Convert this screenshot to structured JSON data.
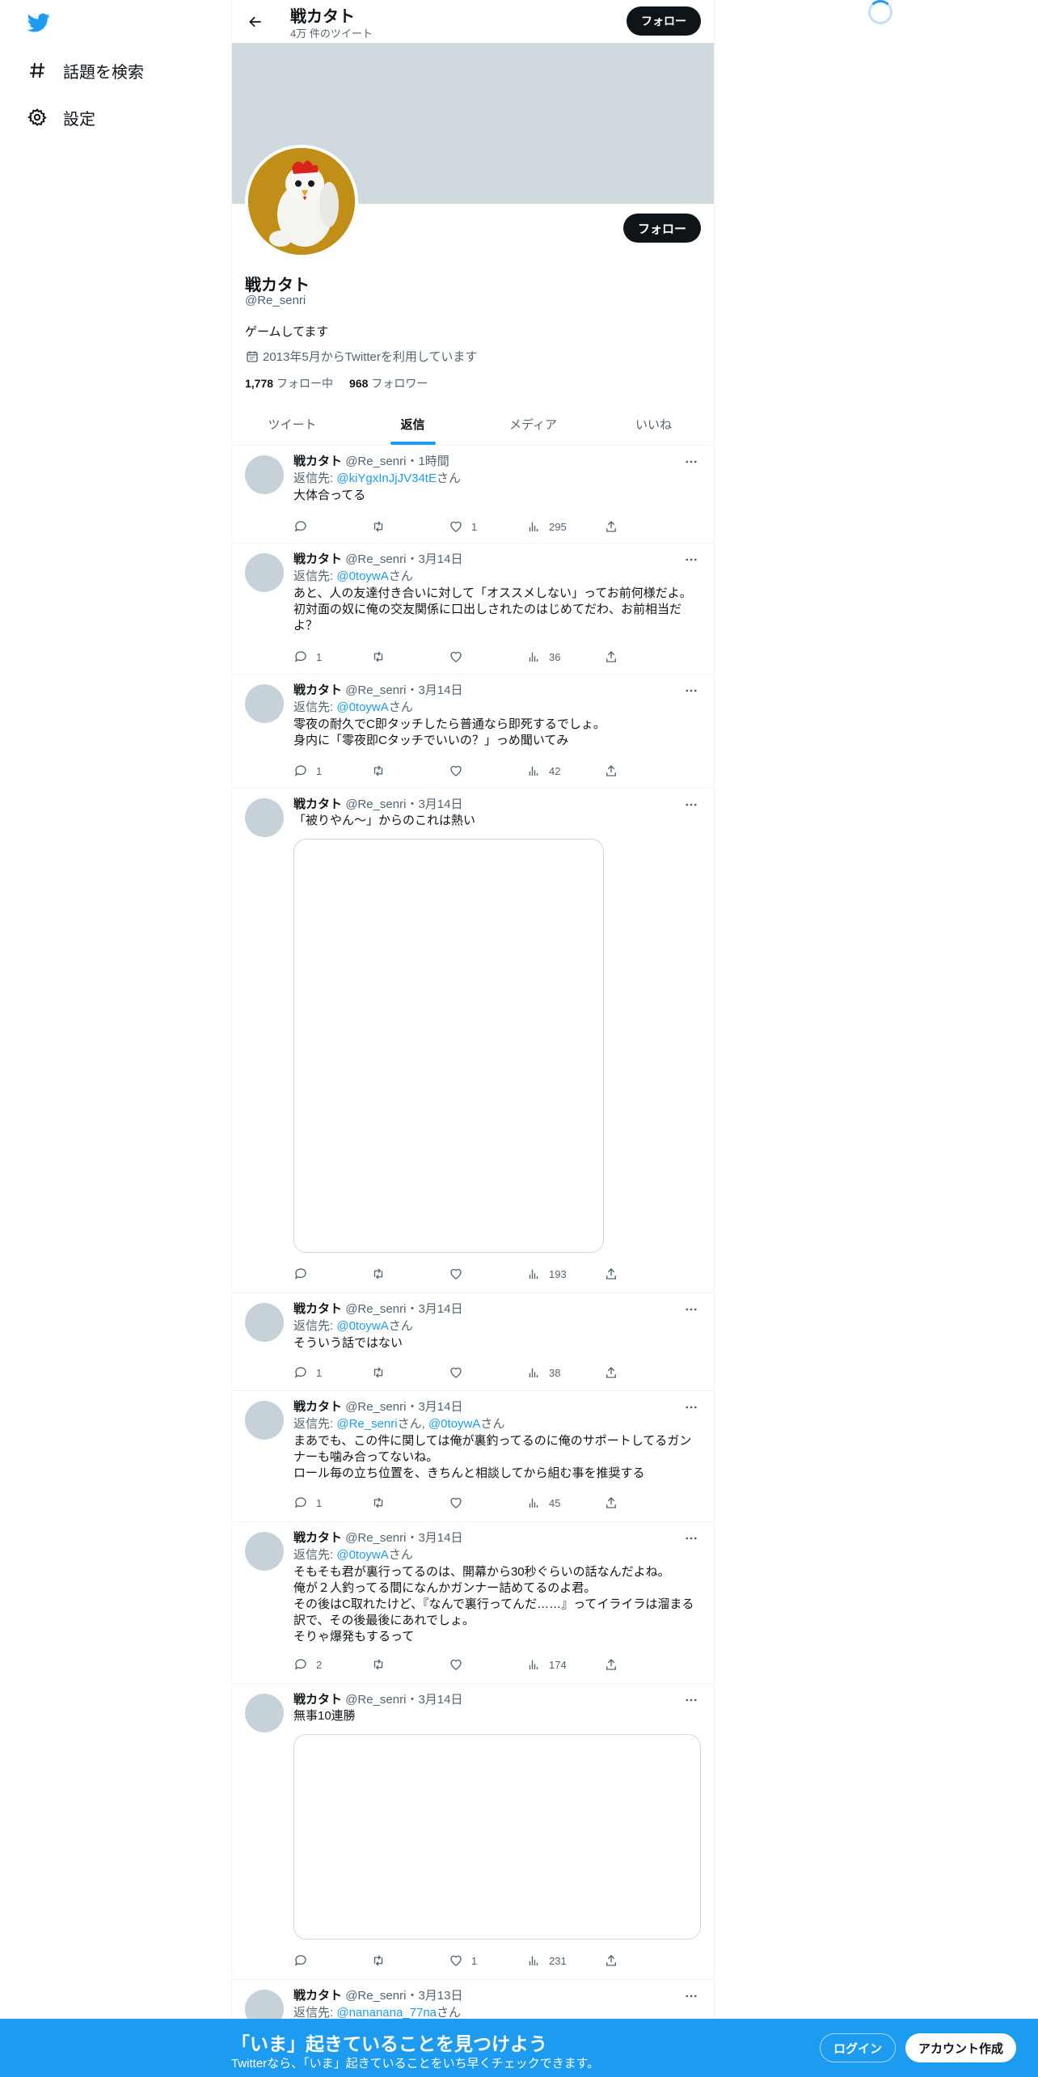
{
  "sidebar": {
    "items": [
      {
        "label": "話題を検索",
        "icon": "hashtag-icon"
      },
      {
        "label": "設定",
        "icon": "gear-icon"
      }
    ]
  },
  "header": {
    "name": "戦カタト",
    "tweet_count": "4万 件のツイート",
    "follow_label": "フォロー"
  },
  "profile": {
    "name": "戦カタト",
    "handle": "@Re_senri",
    "bio": "ゲームしてます",
    "joined": "2013年5月からTwitterを利用しています",
    "following_count": "1,778",
    "following_label": "フォロー中",
    "followers_count": "968",
    "followers_label": "フォロワー",
    "follow_label": "フォロー"
  },
  "tabs": [
    {
      "label": "ツイート",
      "active": false
    },
    {
      "label": "返信",
      "active": true
    },
    {
      "label": "メディア",
      "active": false
    },
    {
      "label": "いいね",
      "active": false
    }
  ],
  "tweets": [
    {
      "name": "戦カタト",
      "meta": "@Re_senri・1時間",
      "reply_prefix": "返信先: ",
      "reply_mentions": "@kiYgxInJjJV34tE",
      "reply_suffix": "さん",
      "text": "大体合ってる",
      "replies": "",
      "retweets": "",
      "likes": "1",
      "views": "295"
    },
    {
      "name": "戦カタト",
      "meta": "@Re_senri・3月14日",
      "reply_prefix": "返信先: ",
      "reply_mentions": "@0toywA",
      "reply_suffix": "さん",
      "text": "あと、人の友達付き合いに対して「オススメしない」ってお前何様だよ。\n初対面の奴に俺の交友関係に口出しされたのはじめてだわ、お前相当だよ？",
      "replies": "1",
      "retweets": "",
      "likes": "",
      "views": "36"
    },
    {
      "name": "戦カタト",
      "meta": "@Re_senri・3月14日",
      "reply_prefix": "返信先: ",
      "reply_mentions": "@0toywA",
      "reply_suffix": "さん",
      "text": "零夜の耐久でC即タッチしたら普通なら即死するでしょ。\n身内に「零夜即Cタッチでいいの？」っめ聞いてみ",
      "replies": "1",
      "retweets": "",
      "likes": "",
      "views": "42"
    },
    {
      "name": "戦カタト",
      "meta": "@Re_senri・3月14日",
      "text": "「被りやん〜」からのこれは熱い",
      "replies": "",
      "retweets": "",
      "likes": "",
      "views": "193"
    },
    {
      "name": "戦カタト",
      "meta": "@Re_senri・3月14日",
      "reply_prefix": "返信先: ",
      "reply_mentions": "@0toywA",
      "reply_suffix": "さん",
      "text": "そういう話ではない",
      "replies": "1",
      "retweets": "",
      "likes": "",
      "views": "38"
    },
    {
      "name": "戦カタト",
      "meta": "@Re_senri・3月14日",
      "reply_prefix": "返信先: ",
      "reply_mentions": "@Re_senri",
      "reply_mid": "さん, ",
      "reply_mentions2": "@0toywA",
      "reply_suffix": "さん",
      "text": "まあでも、この件に関しては俺が裏釣ってるのに俺のサポートしてるガンナーも噛み合ってないね。\nロール毎の立ち位置を、きちんと相談してから組む事を推奨する",
      "replies": "1",
      "retweets": "",
      "likes": "",
      "views": "45"
    },
    {
      "name": "戦カタト",
      "meta": "@Re_senri・3月14日",
      "reply_prefix": "返信先: ",
      "reply_mentions": "@0toywA",
      "reply_suffix": "さん",
      "text": "そもそも君が裏行ってるのは、開幕から30秒ぐらいの話なんだよね。\n俺が２人釣ってる間になんかガンナー詰めてるのよ君。\nその後はC取れたけど、『なんで裏行ってんだ……』ってイライラは溜まる訳で、その後最後にあれでしょ。\nそりゃ爆発もするって",
      "replies": "2",
      "retweets": "",
      "likes": "",
      "views": "174"
    },
    {
      "name": "戦カタト",
      "meta": "@Re_senri・3月14日",
      "text": "無事10連勝",
      "replies": "",
      "retweets": "",
      "likes": "1",
      "views": "231"
    },
    {
      "name": "戦カタト",
      "meta": "@Re_senri・3月13日",
      "reply_prefix": "返信先: ",
      "reply_mentions": "@nananana_77na",
      "reply_suffix": "さん"
    }
  ],
  "bottom": {
    "title": "「いま」起きていることを見つけよう",
    "subtitle": "Twitterなら、「いま」起きていることをいち早くチェックできます。",
    "login_label": "ログイン",
    "signup_label": "アカウント作成"
  },
  "colors": {
    "accent": "#1d9bf0",
    "banner": "#cfd9de",
    "text": "#0f1419",
    "secondary": "#536471"
  }
}
